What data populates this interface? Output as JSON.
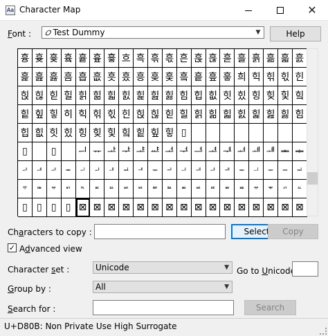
{
  "window": {
    "title": "Character Map"
  },
  "font": {
    "label": "Font :",
    "value": "Test Dummy",
    "prefix": "𝑂"
  },
  "buttons": {
    "help": "Help",
    "select": "Select",
    "copy": "Copy",
    "search": "Search"
  },
  "copy": {
    "label": "Characters to copy :",
    "value": ""
  },
  "advanced": {
    "label": "Advanced view",
    "checked": true,
    "check_glyph": "✓"
  },
  "charset": {
    "label": "Character set :",
    "value": "Unicode"
  },
  "goto_unicode": {
    "label": "Go to Unicode :",
    "value": ""
  },
  "group_by": {
    "label": "Group by :",
    "value": "All"
  },
  "search_for": {
    "label": "Search for :",
    "value": ""
  },
  "status": {
    "text": "U+D80B: Non Private Use High Surrogate"
  },
  "grid": {
    "selected_index": 164,
    "small_rows": [
      6,
      7
    ],
    "rows": [
      [
        "흉",
        "흊",
        "흋",
        "흌",
        "흍",
        "흎",
        "흏",
        "흐",
        "흑",
        "흒",
        "흓",
        "흔",
        "흕",
        "흖",
        "흗",
        "흘",
        "흙",
        "흚",
        "흛",
        "흜"
      ],
      [
        "흝",
        "흞",
        "흟",
        "흠",
        "흡",
        "흢",
        "흣",
        "흤",
        "흥",
        "흦",
        "흧",
        "흨",
        "흩",
        "흪",
        "흫",
        "희",
        "힉",
        "힊",
        "힋",
        "힌"
      ],
      [
        "힍",
        "힎",
        "힏",
        "힐",
        "힑",
        "힒",
        "힓",
        "힔",
        "힕",
        "힖",
        "힗",
        "힘",
        "힙",
        "힚",
        "힛",
        "힜",
        "힝",
        "힞",
        "힟",
        "힠"
      ],
      [
        "힡",
        "힢",
        "힣",
        "히",
        "힉",
        "힊",
        "힋",
        "힌",
        "힍",
        "힎",
        "힏",
        "힐",
        "힑",
        "힒",
        "힓",
        "힔",
        "힕",
        "힖",
        "힗",
        "힘"
      ],
      [
        "힙",
        "힚",
        "힛",
        "힜",
        "힝",
        "힞",
        "힟",
        "힠",
        "힡",
        "힢",
        "힣",
        "▯",
        "",
        "",
        "",
        "",
        "",
        "",
        "",
        ""
      ],
      [
        "▯",
        "",
        "▯",
        "",
        "ᅴ",
        "ᅲ",
        "ᅶ",
        "ᅷ",
        "ᅸ",
        "ᅹ",
        "ᅺ",
        "ᅻ",
        "ᅼ",
        "ᅽ",
        "ᅾ",
        "ᅿ",
        "ᆀ",
        "ᆁ",
        "ᆂ",
        "ᆃ"
      ],
      [
        "ᆄ",
        "ᆅ",
        "ᆆ",
        "ᆇ",
        "ᆈ",
        "ᆉ",
        "ᆊ",
        "ᆋ",
        "ᆌ",
        "ᆍ",
        "ᆎ",
        "ᆏ",
        "ᆐ",
        "ᆑ",
        "ᆒ",
        "ᆓ",
        "ᆔ",
        "ᆕ",
        "ᆖ",
        "ᆗ"
      ],
      [
        "ᄛ",
        "ᄜ",
        "ᄝ",
        "ᄞ",
        "ᄟ",
        "ᄠ",
        "ᄡ",
        "ᄢ",
        "ᄣ",
        "ᄤ",
        "ᄥ",
        "ᄦ",
        "ᄧ",
        "ᄨ",
        "ᄩ",
        "ᄪ",
        "ᄫ",
        "ᄬ",
        "ᄭ",
        "ᄮ"
      ],
      [
        "▯",
        "▯",
        "▯",
        "▯",
        "⊠",
        "⊠",
        "⊠",
        "⊠",
        "⊠",
        "⊠",
        "⊠",
        "⊠",
        "⊠",
        "⊠",
        "⊠",
        "⊠",
        "⊠",
        "⊠",
        "⊠",
        "⊠"
      ]
    ]
  }
}
